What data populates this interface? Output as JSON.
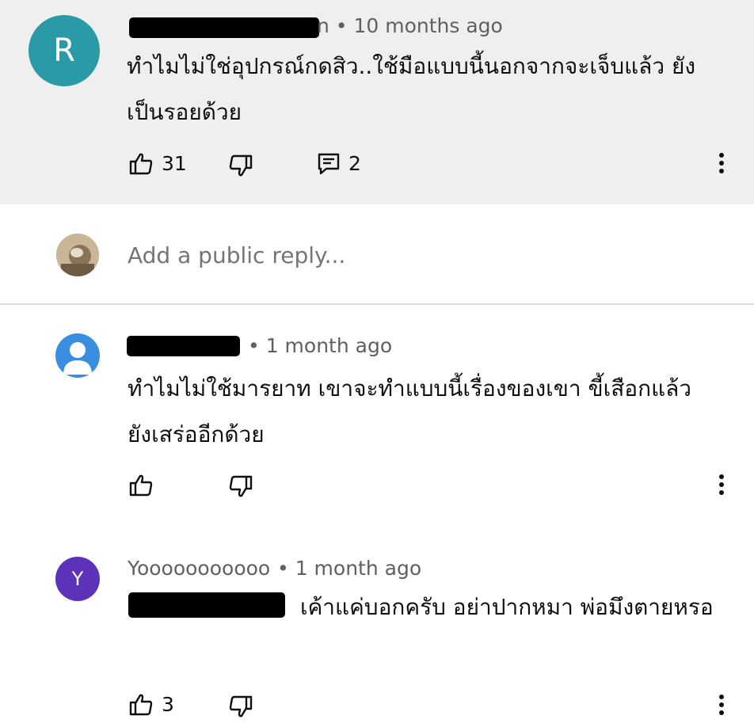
{
  "comment_1": {
    "avatar_letter": "R",
    "avatar_color": "#2a9aa7",
    "meta": "n • 10 months ago",
    "body": "ทำไมไม่ใช่อุปกรณ์กดสิว..ใช้มือแบบนี้นอกจากจะเจ็บแล้ว ยังเป็นรอยด้วย",
    "likes": "31",
    "replies": "2"
  },
  "reply_box": {
    "placeholder": "Add a public reply..."
  },
  "reply_1": {
    "avatar_color": "#3a8ee0",
    "meta": "• 1 month ago",
    "body": "ทำไมไม่ใช้มารยาท เขาจะทำแบบนี้เรื่องของเขา ขี้เสือกแล้วยังเสร่ออีกด้วย"
  },
  "reply_2": {
    "avatar_letter": "Y",
    "avatar_color": "#5b32b8",
    "author": "Yooooooooooo",
    "meta": "• 1 month ago",
    "body": "เค้าแค่บอกครับ อย่าปากหมา พ่อมึงตายหรอ",
    "likes": "3"
  },
  "icons": {
    "like": "thumb-up-icon",
    "dislike": "thumb-down-icon",
    "reply": "reply-comment-icon",
    "more": "more-vertical-icon"
  }
}
